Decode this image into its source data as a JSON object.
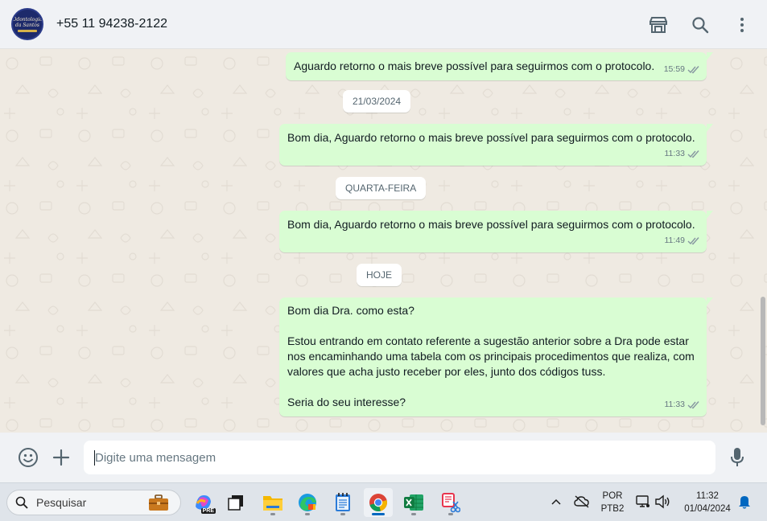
{
  "header": {
    "avatar_line1": "Odontologia",
    "avatar_line2": "da Santos",
    "contact": "+55 11 94238-2122",
    "icons": [
      "shop-icon",
      "search-icon",
      "more-vertical-icon"
    ]
  },
  "messages": [
    {
      "text": "Aguardo retorno o mais breve possível para seguirmos com o protocolo.",
      "time": "15:59"
    },
    {
      "date": "21/03/2024"
    },
    {
      "text": "Bom dia, Aguardo retorno o mais breve possível para seguirmos com o protocolo.",
      "time": "11:33"
    },
    {
      "date": "QUARTA-FEIRA"
    },
    {
      "text": "Bom dia, Aguardo retorno o mais breve possível para seguirmos com o protocolo.",
      "time": "11:49"
    },
    {
      "date": "HOJE"
    },
    {
      "lines": [
        "Bom dia Dra. como esta?",
        "",
        "Estou entrando em contato referente a sugestão anterior sobre a Dra pode estar",
        "nos encaminhando uma tabela com os principais procedimentos que realiza, com",
        "valores que acha justo receber por eles, junto dos códigos tuss.",
        "",
        "Seria do seu interesse?"
      ],
      "time": "11:33"
    }
  ],
  "composer": {
    "placeholder": "Digite uma mensagem",
    "icons": [
      "emoji-icon",
      "plus-icon",
      "microphone-icon"
    ]
  },
  "taskbar": {
    "search_label": "Pesquisar",
    "copilot_badge": "PRE",
    "language": "POR",
    "layout": "PTB2",
    "time": "11:32",
    "date": "01/04/2024"
  },
  "colors": {
    "outgoing_bubble": "#d9fdd3",
    "chat_background": "#efeae2",
    "panel": "#f0f2f5",
    "tick_blue": "#8696a0"
  }
}
